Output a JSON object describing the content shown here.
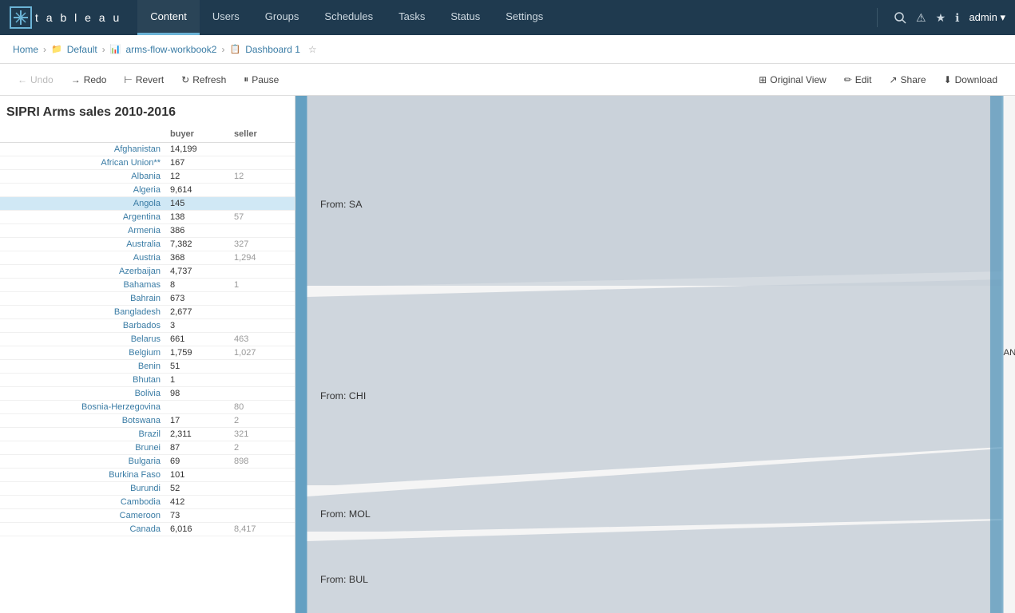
{
  "nav": {
    "logo_letters": "tableau",
    "items": [
      {
        "label": "Content",
        "active": true
      },
      {
        "label": "Users",
        "active": false
      },
      {
        "label": "Groups",
        "active": false
      },
      {
        "label": "Schedules",
        "active": false
      },
      {
        "label": "Tasks",
        "active": false
      },
      {
        "label": "Status",
        "active": false
      },
      {
        "label": "Settings",
        "active": false
      }
    ],
    "admin_label": "admin ▾",
    "icons": [
      "⚠",
      "★",
      "ℹ"
    ]
  },
  "breadcrumb": {
    "items": [
      {
        "label": "Home",
        "icon": ""
      },
      {
        "label": "Default",
        "icon": "📁"
      },
      {
        "label": "arms-flow-workbook2",
        "icon": "📊"
      },
      {
        "label": "Dashboard 1",
        "icon": "📋"
      }
    ]
  },
  "toolbar": {
    "undo_label": "Undo",
    "redo_label": "Redo",
    "revert_label": "Revert",
    "refresh_label": "Refresh",
    "pause_label": "Pause",
    "original_view_label": "Original View",
    "edit_label": "Edit",
    "share_label": "Share",
    "download_label": "Download"
  },
  "panel": {
    "title": "SIPRI Arms sales 2010-2016",
    "col_buyer": "buyer",
    "col_seller": "seller",
    "rows": [
      {
        "country": "Afghanistan",
        "buyer": "14,199",
        "seller": ""
      },
      {
        "country": "African Union**",
        "buyer": "167",
        "seller": ""
      },
      {
        "country": "Albania",
        "buyer": "12",
        "seller": "12"
      },
      {
        "country": "Algeria",
        "buyer": "9,614",
        "seller": ""
      },
      {
        "country": "Angola",
        "buyer": "145",
        "seller": "",
        "selected": true
      },
      {
        "country": "Argentina",
        "buyer": "138",
        "seller": "57"
      },
      {
        "country": "Armenia",
        "buyer": "386",
        "seller": ""
      },
      {
        "country": "Australia",
        "buyer": "7,382",
        "seller": "327"
      },
      {
        "country": "Austria",
        "buyer": "368",
        "seller": "1,294"
      },
      {
        "country": "Azerbaijan",
        "buyer": "4,737",
        "seller": ""
      },
      {
        "country": "Bahamas",
        "buyer": "8",
        "seller": "1"
      },
      {
        "country": "Bahrain",
        "buyer": "673",
        "seller": ""
      },
      {
        "country": "Bangladesh",
        "buyer": "2,677",
        "seller": ""
      },
      {
        "country": "Barbados",
        "buyer": "3",
        "seller": ""
      },
      {
        "country": "Belarus",
        "buyer": "661",
        "seller": "463"
      },
      {
        "country": "Belgium",
        "buyer": "1,759",
        "seller": "1,027"
      },
      {
        "country": "Benin",
        "buyer": "51",
        "seller": ""
      },
      {
        "country": "Bhutan",
        "buyer": "1",
        "seller": ""
      },
      {
        "country": "Bolivia",
        "buyer": "98",
        "seller": ""
      },
      {
        "country": "Bosnia-Herzegovina",
        "buyer": "",
        "seller": "80"
      },
      {
        "country": "Botswana",
        "buyer": "17",
        "seller": "2"
      },
      {
        "country": "Brazil",
        "buyer": "2,311",
        "seller": "321"
      },
      {
        "country": "Brunei",
        "buyer": "87",
        "seller": "2"
      },
      {
        "country": "Bulgaria",
        "buyer": "69",
        "seller": "898"
      },
      {
        "country": "Burkina Faso",
        "buyer": "101",
        "seller": ""
      },
      {
        "country": "Burundi",
        "buyer": "52",
        "seller": ""
      },
      {
        "country": "Cambodia",
        "buyer": "412",
        "seller": ""
      },
      {
        "country": "Cameroon",
        "buyer": "73",
        "seller": ""
      },
      {
        "country": "Canada",
        "buyer": "6,016",
        "seller": "8,417"
      }
    ]
  },
  "chart": {
    "ang_label": "ANG",
    "flows": [
      {
        "label": "From: SA",
        "y_pct": 22
      },
      {
        "label": "From: CHI",
        "y_pct": 52
      },
      {
        "label": "From: MOL",
        "y_pct": 74
      },
      {
        "label": "From: BUL",
        "y_pct": 92
      }
    ]
  }
}
